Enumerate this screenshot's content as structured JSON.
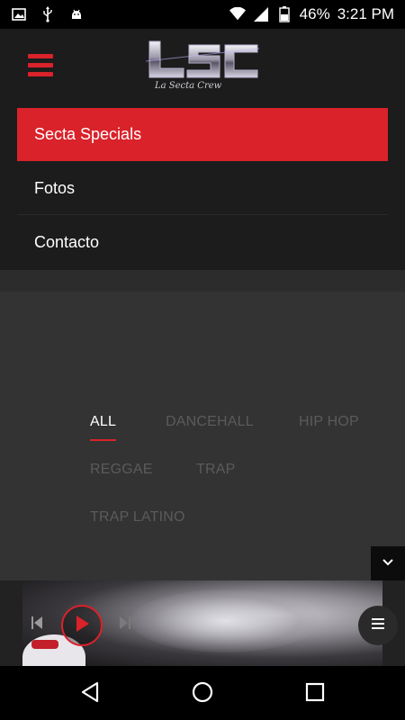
{
  "status_bar": {
    "icons_left": [
      "image-icon",
      "usb-icon",
      "android-icon"
    ],
    "battery": "46%",
    "time": "3:21 PM"
  },
  "header": {
    "logo_text": "LSC",
    "logo_subtitle": "La Secta Crew"
  },
  "menu": {
    "items": [
      {
        "label": "Secta Specials",
        "active": true
      },
      {
        "label": "Fotos",
        "active": false
      },
      {
        "label": "Contacto",
        "active": false
      }
    ]
  },
  "filters": {
    "items": [
      {
        "label": "ALL",
        "active": true
      },
      {
        "label": "DANCEHALL",
        "active": false
      },
      {
        "label": "HIP HOP",
        "active": false
      },
      {
        "label": "REGGAE",
        "active": false
      },
      {
        "label": "TRAP",
        "active": false
      },
      {
        "label": "TRAP LATINO",
        "active": false
      }
    ]
  },
  "colors": {
    "accent": "#d9222a",
    "header_bg": "#1c1c1c",
    "content_bg": "#333333",
    "inactive_filter": "#5b5b5b"
  }
}
